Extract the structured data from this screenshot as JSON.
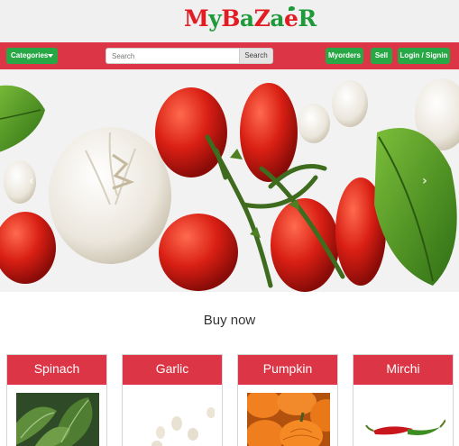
{
  "brand": {
    "logo_text": "MyBaZaeR"
  },
  "navbar": {
    "categories_label": "Categories",
    "search_placeholder": "Search",
    "search_button": "Search",
    "myorders_label": "Myorders",
    "sell_label": "Sell",
    "login_label": "Login / Signin"
  },
  "carousel": {
    "prev_icon": "chevron-left-icon",
    "next_icon": "chevron-right-icon",
    "prev_glyph": "‹",
    "next_glyph": "›"
  },
  "section": {
    "title": "Buy now"
  },
  "products": [
    {
      "name": "Spinach"
    },
    {
      "name": "Garlic"
    },
    {
      "name": "Pumpkin"
    },
    {
      "name": "Mirchi"
    }
  ],
  "colors": {
    "brand_red": "#dc3545",
    "button_green": "#28a745",
    "logo_red": "#e31b23",
    "logo_green": "#1f9a3a"
  }
}
